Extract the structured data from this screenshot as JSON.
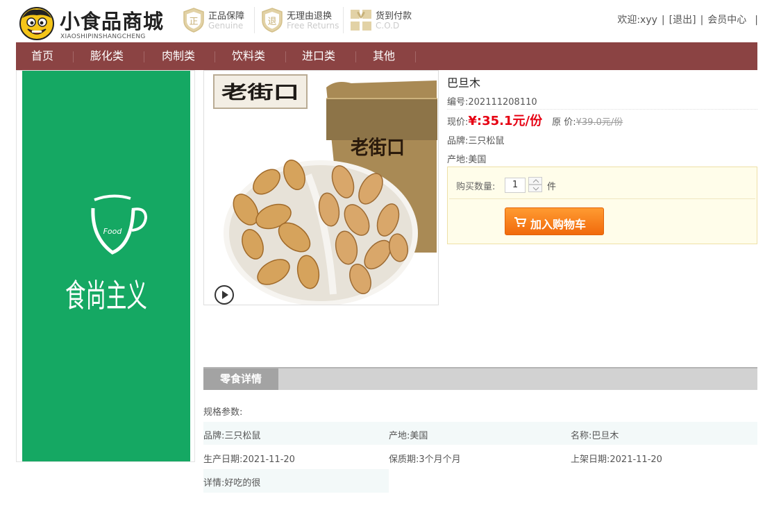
{
  "header": {
    "logo_title": "小食品商城",
    "logo_subtitle": "XIAOSHIPINSHANGCHENG",
    "badges": [
      {
        "icon": "genuine-shield-icon",
        "glyph": "正",
        "title": "正品保障",
        "subtitle": "Genuine"
      },
      {
        "icon": "return-shield-icon",
        "glyph": "退",
        "title": "无理由退换",
        "subtitle": "Free Returns"
      },
      {
        "icon": "gift-box-icon",
        "glyph": "",
        "title": "货到付款",
        "subtitle": "C.O.D"
      }
    ],
    "user": {
      "welcome": "欢迎:xyy",
      "logout": "[退出]",
      "member_center": "会员中心"
    }
  },
  "nav": {
    "items": [
      "首页",
      "膨化类",
      "肉制类",
      "饮料类",
      "进口类",
      "其他"
    ]
  },
  "banner": {
    "image_text": "食尚主义",
    "cup_text": "Food"
  },
  "product": {
    "image_text": "老街口",
    "name": "巴旦木",
    "code": "编号:202111208110",
    "price_label": "现价:",
    "price": "¥:35.1元/份",
    "orig_label": "原 价:",
    "orig_price": "¥39.0元/份",
    "brand": "品牌:三只松鼠",
    "origin": "产地:美国"
  },
  "buy": {
    "qty_label": "购买数量:",
    "qty_value": "1",
    "qty_unit": "件",
    "cart_button": "加入购物车"
  },
  "details": {
    "tab_label": "零食详情",
    "spec_label": "规格参数:",
    "rows": [
      [
        "品牌:三只松鼠",
        "产地:美国",
        "名称:巴旦木"
      ],
      [
        "生产日期:2021-11-20",
        "保质期:3个月个月",
        "上架日期:2021-11-20"
      ],
      [
        "详情:好吃的很"
      ]
    ]
  },
  "colors": {
    "nav_bg": "#8b4343",
    "banner_green": "#15a863",
    "price_red": "#e60012",
    "cart_orange": "#f57f17",
    "buybox_bg": "#fffdea"
  }
}
